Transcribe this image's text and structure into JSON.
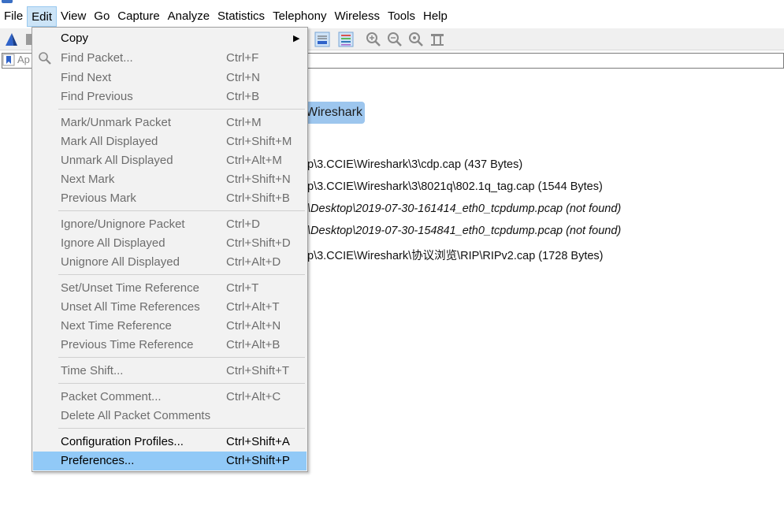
{
  "menubar": {
    "items": [
      {
        "label": "File"
      },
      {
        "label": "Edit"
      },
      {
        "label": "View"
      },
      {
        "label": "Go"
      },
      {
        "label": "Capture"
      },
      {
        "label": "Analyze"
      },
      {
        "label": "Statistics"
      },
      {
        "label": "Telephony"
      },
      {
        "label": "Wireless"
      },
      {
        "label": "Tools"
      },
      {
        "label": "Help"
      }
    ],
    "active": "Edit"
  },
  "filter": {
    "placeholder": "Ap"
  },
  "welcome": {
    "chip_text": "Wireshark",
    "recent_files": [
      {
        "text": "p\\3.CCIE\\Wireshark\\3\\cdp.cap (437 Bytes)",
        "italic": false
      },
      {
        "text": "p\\3.CCIE\\Wireshark\\3\\8021q\\802.1q_tag.cap (1544 Bytes)",
        "italic": false
      },
      {
        "text": "\\Desktop\\2019-07-30-161414_eth0_tcpdump.pcap (not found)",
        "italic": true
      },
      {
        "text": "\\Desktop\\2019-07-30-154841_eth0_tcpdump.pcap (not found)",
        "italic": true
      },
      {
        "text": "p\\3.CCIE\\Wireshark\\协议浏览\\RIP\\RIPv2.cap (1728 Bytes)",
        "italic": false
      }
    ]
  },
  "edit_menu": {
    "copy": {
      "label": "Copy",
      "shortcut": ""
    },
    "find_packet": {
      "label": "Find Packet...",
      "shortcut": "Ctrl+F"
    },
    "find_next": {
      "label": "Find Next",
      "shortcut": "Ctrl+N"
    },
    "find_previous": {
      "label": "Find Previous",
      "shortcut": "Ctrl+B"
    },
    "mark_unmark": {
      "label": "Mark/Unmark Packet",
      "shortcut": "Ctrl+M"
    },
    "mark_all": {
      "label": "Mark All Displayed",
      "shortcut": "Ctrl+Shift+M"
    },
    "unmark_all": {
      "label": "Unmark All Displayed",
      "shortcut": "Ctrl+Alt+M"
    },
    "next_mark": {
      "label": "Next Mark",
      "shortcut": "Ctrl+Shift+N"
    },
    "previous_mark": {
      "label": "Previous Mark",
      "shortcut": "Ctrl+Shift+B"
    },
    "ignore_unignore": {
      "label": "Ignore/Unignore Packet",
      "shortcut": "Ctrl+D"
    },
    "ignore_all": {
      "label": "Ignore All Displayed",
      "shortcut": "Ctrl+Shift+D"
    },
    "unignore_all": {
      "label": "Unignore All Displayed",
      "shortcut": "Ctrl+Alt+D"
    },
    "set_time_ref": {
      "label": "Set/Unset Time Reference",
      "shortcut": "Ctrl+T"
    },
    "unset_all_time_refs": {
      "label": "Unset All Time References",
      "shortcut": "Ctrl+Alt+T"
    },
    "next_time_ref": {
      "label": "Next Time Reference",
      "shortcut": "Ctrl+Alt+N"
    },
    "previous_time_ref": {
      "label": "Previous Time Reference",
      "shortcut": "Ctrl+Alt+B"
    },
    "time_shift": {
      "label": "Time Shift...",
      "shortcut": "Ctrl+Shift+T"
    },
    "packet_comment": {
      "label": "Packet Comment...",
      "shortcut": "Ctrl+Alt+C"
    },
    "delete_all_comments": {
      "label": "Delete All Packet Comments",
      "shortcut": ""
    },
    "config_profiles": {
      "label": "Configuration Profiles...",
      "shortcut": "Ctrl+Shift+A"
    },
    "preferences": {
      "label": "Preferences...",
      "shortcut": "Ctrl+Shift+P"
    }
  },
  "colors": {
    "menu_highlight": "#91c9f7",
    "menubar_active": "#cce4f7",
    "welcome_chip": "#9dc6ee"
  }
}
